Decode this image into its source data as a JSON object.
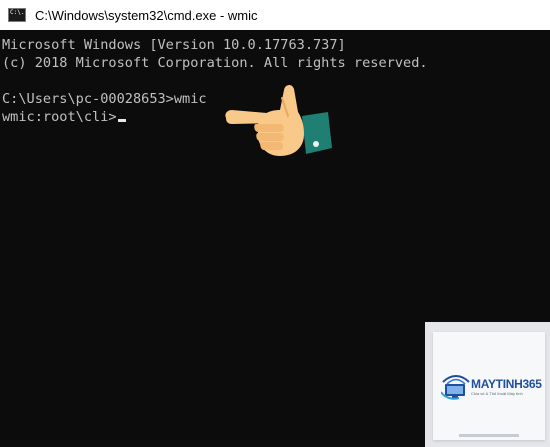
{
  "window": {
    "title": "C:\\Windows\\system32\\cmd.exe - wmic",
    "icon_text": "C:\\."
  },
  "console": {
    "lines": [
      "Microsoft Windows [Version 10.0.17763.737]",
      "(c) 2018 Microsoft Corporation. All rights reserved.",
      "C:\\Users\\pc-00028653>wmic",
      "wmic:root\\cli>"
    ],
    "text_color": "#c0c0c0",
    "background": "#0c0c0c"
  },
  "overlay": {
    "pointer": "pointing-hand-icon",
    "hand_color": "#f9c98a",
    "cuff_color": "#1f7f73"
  },
  "watermark": {
    "brand": "MAYTINH365",
    "tagline": "Chia sẻ & Thủ thuật Máy tính",
    "logo": "computer-wifi-logo",
    "brand_color": "#1f4f9e"
  }
}
